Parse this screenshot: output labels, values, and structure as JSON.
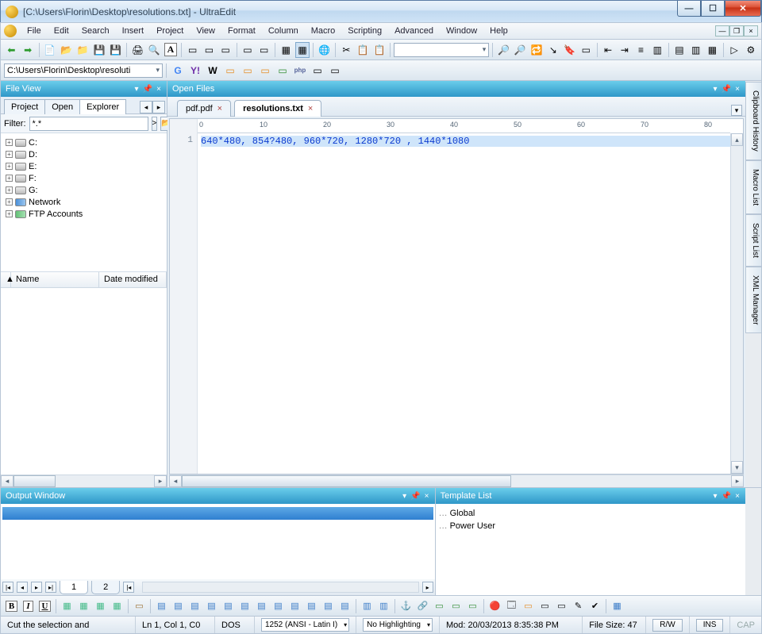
{
  "title": "[C:\\Users\\Florin\\Desktop\\resolutions.txt] - UltraEdit",
  "menus": [
    "File",
    "Edit",
    "Search",
    "Insert",
    "Project",
    "View",
    "Format",
    "Column",
    "Macro",
    "Scripting",
    "Advanced",
    "Window",
    "Help"
  ],
  "address_bar": "C:\\Users\\Florin\\Desktop\\resoluti",
  "file_view": {
    "title": "File View",
    "tabs": [
      "Project",
      "Open",
      "Explorer"
    ],
    "active_tab": "Explorer",
    "filter_label": "Filter:",
    "filter_value": "*.*",
    "drives": [
      "C:",
      "D:",
      "E:",
      "F:",
      "G:",
      "Network",
      "FTP Accounts"
    ],
    "cols": {
      "name": "Name",
      "modified": "Date modified"
    }
  },
  "open_files": {
    "title": "Open Files",
    "tabs": [
      {
        "label": "pdf.pdf",
        "active": false
      },
      {
        "label": "resolutions.txt",
        "active": true
      }
    ]
  },
  "editor": {
    "ruler_ticks": [
      "0",
      "10",
      "20",
      "30",
      "40",
      "50",
      "60",
      "70",
      "80"
    ],
    "line_number": "1",
    "content": "640*480, 854?480, 960*720, 1280*720 , 1440*1080"
  },
  "output_window": {
    "title": "Output Window",
    "tabs": [
      "1",
      "2"
    ]
  },
  "template_list": {
    "title": "Template List",
    "items": [
      "Global",
      "Power User"
    ]
  },
  "side_tabs": [
    "Clipboard History",
    "Macro List",
    "Script List",
    "XML Manager"
  ],
  "status": {
    "hint": "Cut the selection and",
    "pos": "Ln 1, Col 1, C0",
    "fmt": "DOS",
    "enc": "1252 (ANSI - Latin I)",
    "hl": "No Highlighting",
    "mod": "Mod: 20/03/2013 8:35:38 PM",
    "size": "File Size: 47",
    "rw": "R/W",
    "ins": "INS",
    "cap": "CAP"
  }
}
